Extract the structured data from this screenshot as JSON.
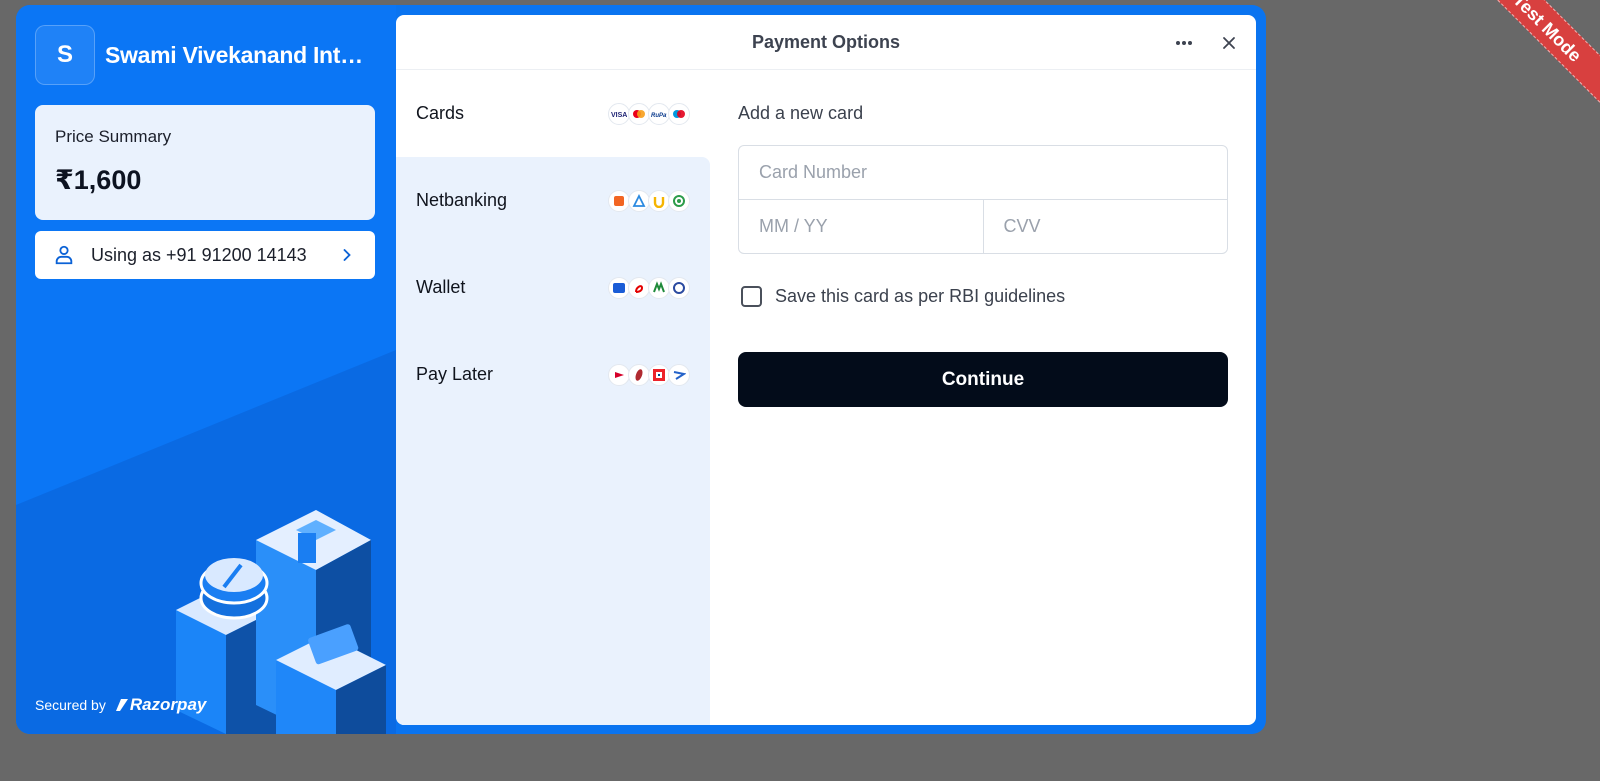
{
  "ribbon": {
    "label": "Test Mode"
  },
  "merchant": {
    "initial": "S",
    "name": "Swami Vivekanand International School"
  },
  "price_summary": {
    "label": "Price Summary",
    "amount": "₹1,600"
  },
  "user": {
    "text": "Using as +91 91200 14143"
  },
  "footer": {
    "secured_by": "Secured by",
    "brand": "Razorpay"
  },
  "panel": {
    "title": "Payment Options"
  },
  "methods": [
    {
      "label": "Cards",
      "icons": [
        "visa-icon",
        "mastercard-icon",
        "rupay-icon",
        "maestro-icon"
      ]
    },
    {
      "label": "Netbanking",
      "icons": [
        "bob-icon",
        "axis-icon",
        "pnb-icon",
        "bank-icon"
      ]
    },
    {
      "label": "Wallet",
      "icons": [
        "mobikwik-icon",
        "airtel-icon",
        "mpay-icon",
        "wallet-icon"
      ]
    },
    {
      "label": "Pay Later",
      "icons": [
        "lazypay-icon",
        "icici-icon",
        "hdfc-icon",
        "paylater-icon"
      ]
    }
  ],
  "form": {
    "title": "Add a new card",
    "card_number_placeholder": "Card Number",
    "expiry_placeholder": "MM / YY",
    "cvv_placeholder": "CVV",
    "save_label": "Save this card as per RBI guidelines",
    "continue_label": "Continue"
  },
  "colors": {
    "brand_blue": "#0b76f5",
    "button_dark": "#030c1a",
    "ribbon_red": "#d8403f"
  }
}
